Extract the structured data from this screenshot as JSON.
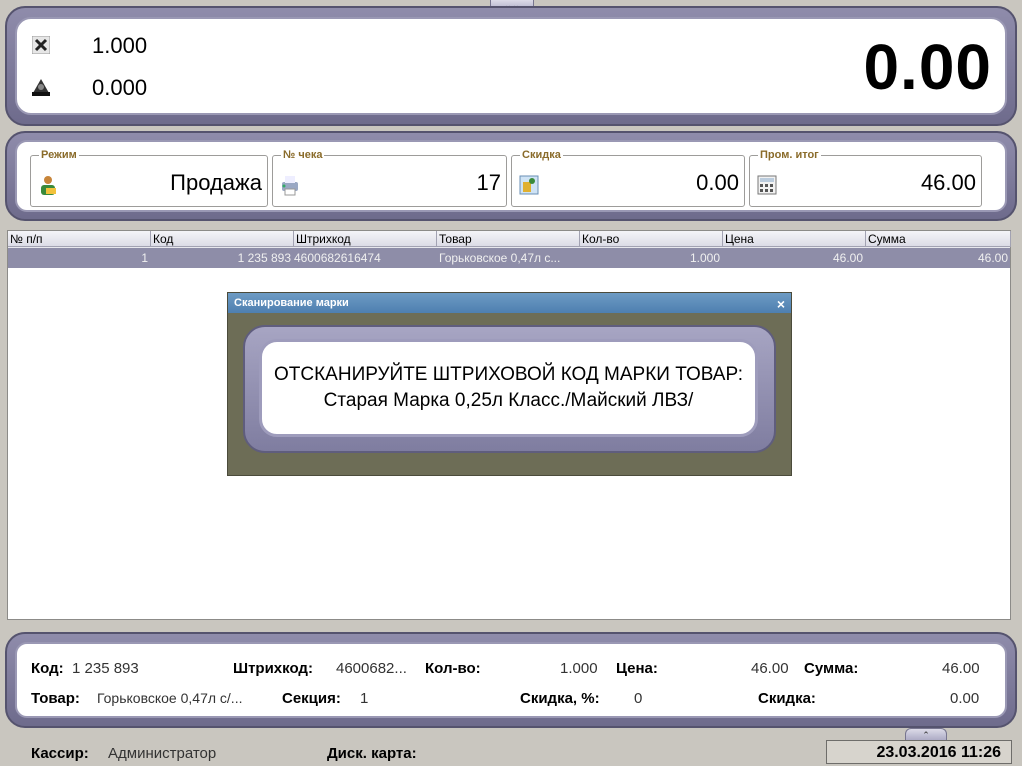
{
  "top": {
    "multiplier": "1.000",
    "weight": "0.000",
    "total": "0.00"
  },
  "info": {
    "mode_title": "Режим",
    "mode_value": "Продажа",
    "receipt_title": "№ чека",
    "receipt_value": "17",
    "discount_title": "Скидка",
    "discount_value": "0.00",
    "subtotal_title": "Пром. итог",
    "subtotal_value": "46.00"
  },
  "table": {
    "headers": [
      "№ п/п",
      "Код",
      "Штрихкод",
      "Товар",
      "Кол-во",
      "Цена",
      "Сумма"
    ],
    "rows": [
      [
        "1",
        "1 235 893",
        "4600682616474",
        "Горьковское 0,47л с...",
        "1.000",
        "46.00",
        "46.00"
      ]
    ]
  },
  "dialog": {
    "title": "Сканирование марки",
    "close": "×",
    "message": "ОТСКАНИРУЙТЕ ШТРИХОВОЙ КОД МАРКИ ТОВАР: Старая Марка 0,25л Класс./Майский ЛВЗ/"
  },
  "details": {
    "code_label": "Код:",
    "code_value": "1 235 893",
    "barcode_label": "Штрихкод:",
    "barcode_value": "4600682...",
    "qty_label": "Кол-во:",
    "qty_value": "1.000",
    "price_label": "Цена:",
    "price_value": "46.00",
    "sum_label": "Сумма:",
    "sum_value": "46.00",
    "item_label": "Товар:",
    "item_value": "Горьковское 0,47л с/...",
    "section_label": "Секция:",
    "section_value": "1",
    "discount_pct_label": "Скидка, %:",
    "discount_pct_value": "0",
    "discount_label": "Скидка:",
    "discount_value": "0.00"
  },
  "status": {
    "cashier_label": "Кассир:",
    "cashier_value": "Администратор",
    "card_label": "Диск. карта:",
    "datetime": "23.03.2016 11:26"
  },
  "colors": {
    "panel_frame": "#7d7a9c",
    "selected_row": "#8e8da8",
    "dialog_title": "#5a8bbb"
  }
}
